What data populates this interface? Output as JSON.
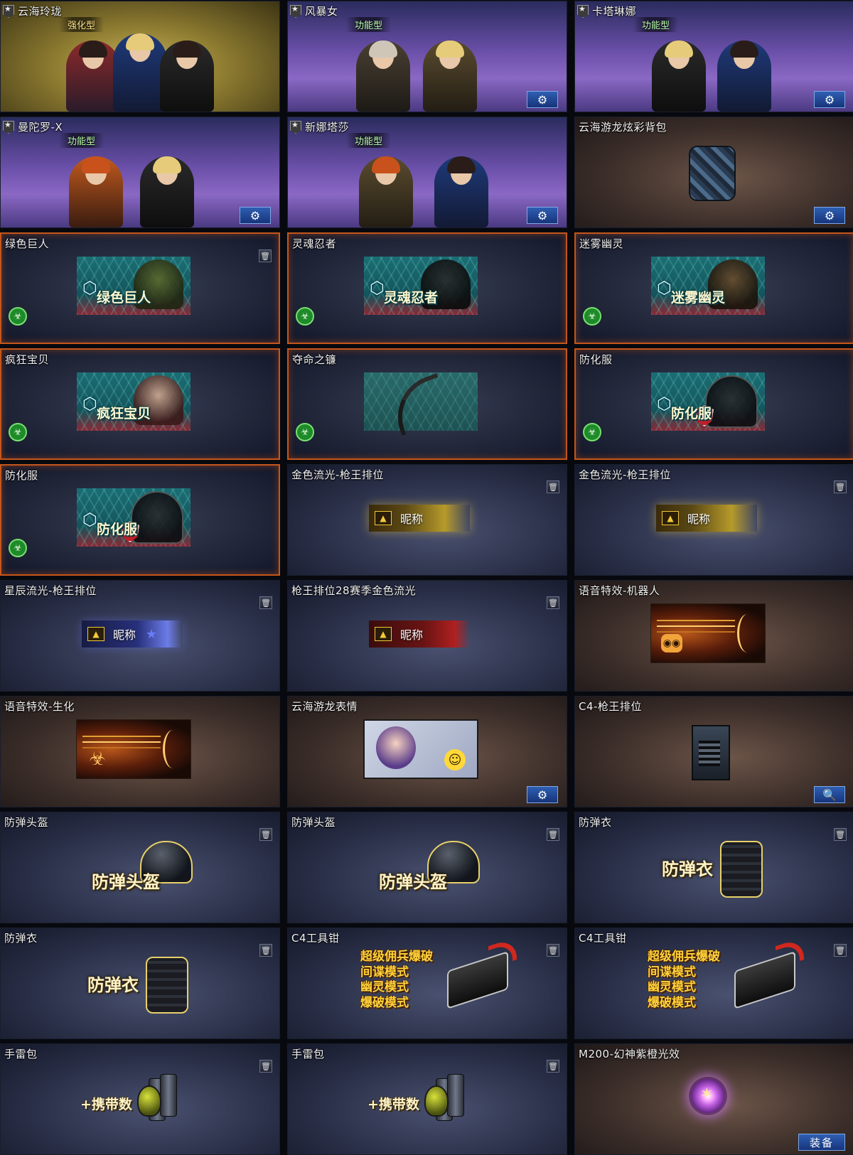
{
  "cards": [
    {
      "title": "云海玲珑",
      "subtype": "强化型",
      "button": "gear"
    },
    {
      "title": "风暴女",
      "subtype": "功能型",
      "button": "gear"
    },
    {
      "title": "卡塔琳娜",
      "subtype": "功能型",
      "button": "gear"
    },
    {
      "title": "曼陀罗-X",
      "subtype": "功能型",
      "button": "gear"
    },
    {
      "title": "新娜塔莎",
      "subtype": "功能型",
      "button": "gear"
    },
    {
      "title": "云海游龙炫彩背包",
      "button": "gear"
    },
    {
      "title": "绿色巨人",
      "banner_text": "绿色巨人"
    },
    {
      "title": "灵魂忍者",
      "banner_text": "灵魂忍者"
    },
    {
      "title": "迷雾幽灵",
      "banner_text": "迷雾幽灵"
    },
    {
      "title": "疯狂宝贝",
      "banner_text": "疯狂宝贝"
    },
    {
      "title": "夺命之镰"
    },
    {
      "title": "防化服",
      "banner_text": "防化服"
    },
    {
      "title": "防化服",
      "banner_text": "防化服"
    },
    {
      "title": "金色流光-枪王排位",
      "nameplate": "昵称"
    },
    {
      "title": "金色流光-枪王排位",
      "nameplate": "昵称"
    },
    {
      "title": "星辰流光-枪王排位",
      "nameplate": "昵称"
    },
    {
      "title": "枪王排位28赛季金色流光",
      "nameplate": "昵称"
    },
    {
      "title": "语音特效-机器人"
    },
    {
      "title": "语音特效-生化"
    },
    {
      "title": "云海游龙表情",
      "button": "gear"
    },
    {
      "title": "C4-枪王排位",
      "button": "search"
    },
    {
      "title": "防弹头盔",
      "art_text": "防弹头盔"
    },
    {
      "title": "防弹头盔",
      "art_text": "防弹头盔"
    },
    {
      "title": "防弹衣",
      "art_text": "防弹衣"
    },
    {
      "title": "防弹衣",
      "art_text": "防弹衣"
    },
    {
      "title": "C4工具钳",
      "modes": [
        "超级佣兵爆破",
        "间谍模式",
        "幽灵模式",
        "爆破模式"
      ]
    },
    {
      "title": "C4工具钳",
      "modes": [
        "超级佣兵爆破",
        "间谍模式",
        "幽灵模式",
        "爆破模式"
      ]
    },
    {
      "title": "手雷包",
      "art_text": "+携带数"
    },
    {
      "title": "手雷包",
      "art_text": "+携带数"
    },
    {
      "title": "M200-幻神紫橙光效",
      "button_label": "装备"
    }
  ],
  "icons": {
    "gear": "⚙",
    "search": "🔍",
    "trash": "🗑",
    "bio": "☣",
    "rank": "★"
  },
  "colors": {
    "orange_border": "#c5561a",
    "button_blue": "#2f5fb2",
    "subtype_green": "#b8ffa8",
    "mode_yellow": "#ffd23a"
  }
}
